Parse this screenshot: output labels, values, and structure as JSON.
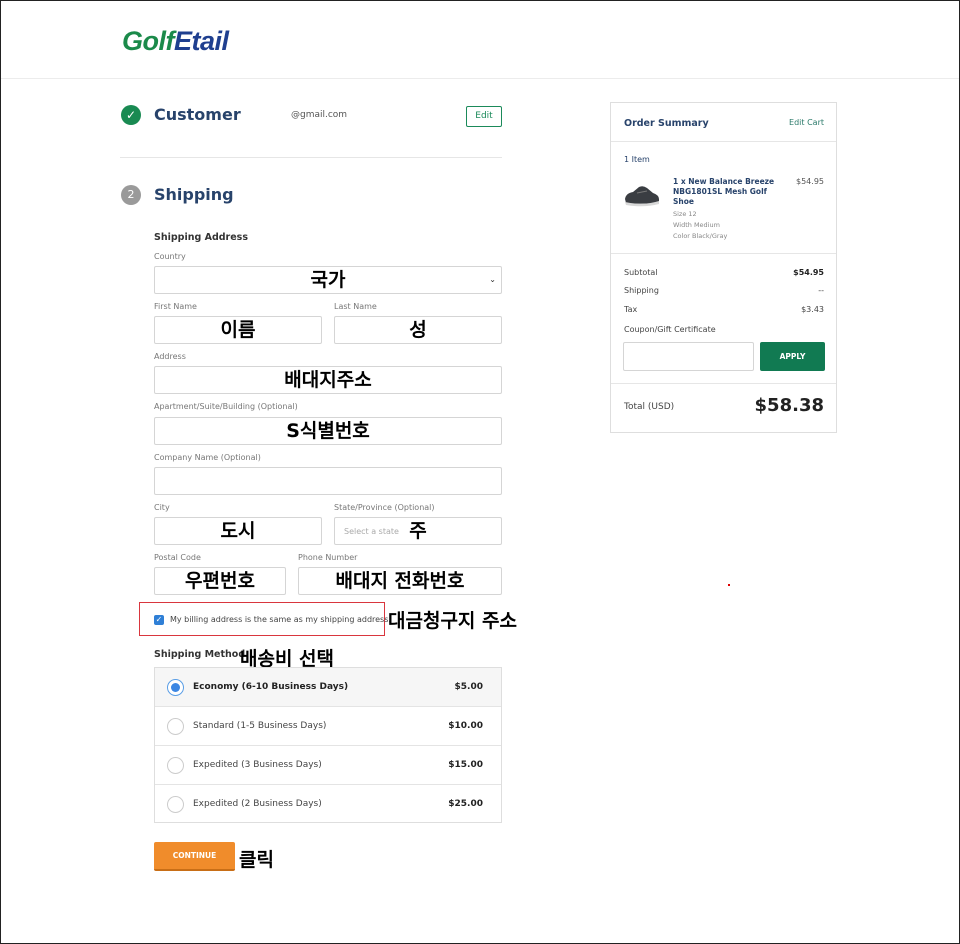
{
  "brand": {
    "logo_part1": "Golf",
    "logo_part2": "Etail"
  },
  "customer": {
    "title": "Customer",
    "email": "@gmail.com",
    "edit_label": "Edit"
  },
  "shipping": {
    "step_number": "2",
    "title": "Shipping",
    "address_heading": "Shipping Address",
    "fields": {
      "country": {
        "label": "Country",
        "annotation": "국가"
      },
      "first_name": {
        "label": "First Name",
        "annotation": "이름"
      },
      "last_name": {
        "label": "Last Name",
        "annotation": "성"
      },
      "address": {
        "label": "Address",
        "annotation": "배대지주소"
      },
      "apartment": {
        "label": "Apartment/Suite/Building (Optional)",
        "annotation": "S식별번호"
      },
      "company": {
        "label": "Company Name (Optional)"
      },
      "city": {
        "label": "City",
        "annotation": "도시"
      },
      "state": {
        "label": "State/Province (Optional)",
        "placeholder": "Select a state",
        "annotation": "주"
      },
      "postal": {
        "label": "Postal Code",
        "annotation": "우편번호"
      },
      "phone": {
        "label": "Phone Number",
        "annotation": "배대지 전화번호"
      }
    },
    "billing_same_label": "My billing address is the same as my shipping address.",
    "billing_annotation": "대금청구지 주소",
    "method_heading": "Shipping Method",
    "method_annotation": "배송비 선택",
    "methods": [
      {
        "name": "Economy (6-10 Business Days)",
        "price": "$5.00",
        "selected": true
      },
      {
        "name": "Standard (1-5 Business Days)",
        "price": "$10.00",
        "selected": false
      },
      {
        "name": "Expedited (3 Business Days)",
        "price": "$15.00",
        "selected": false
      },
      {
        "name": "Expedited (2 Business Days)",
        "price": "$25.00",
        "selected": false
      }
    ],
    "continue_label": "CONTINUE",
    "continue_annotation": "클릭"
  },
  "summary": {
    "title": "Order Summary",
    "edit_cart": "Edit Cart",
    "item_count": "1 Item",
    "item": {
      "name": "1 x New Balance Breeze NBG1801SL Mesh Golf Shoe",
      "price": "$54.95",
      "size": "Size 12",
      "width": "Width Medium",
      "color": "Color Black/Gray"
    },
    "subtotal_label": "Subtotal",
    "subtotal": "$54.95",
    "shipping_label": "Shipping",
    "shipping": "--",
    "tax_label": "Tax",
    "tax": "$3.43",
    "coupon_label": "Coupon/Gift Certificate",
    "apply_label": "APPLY",
    "total_label": "Total (USD)",
    "total": "$58.38"
  }
}
